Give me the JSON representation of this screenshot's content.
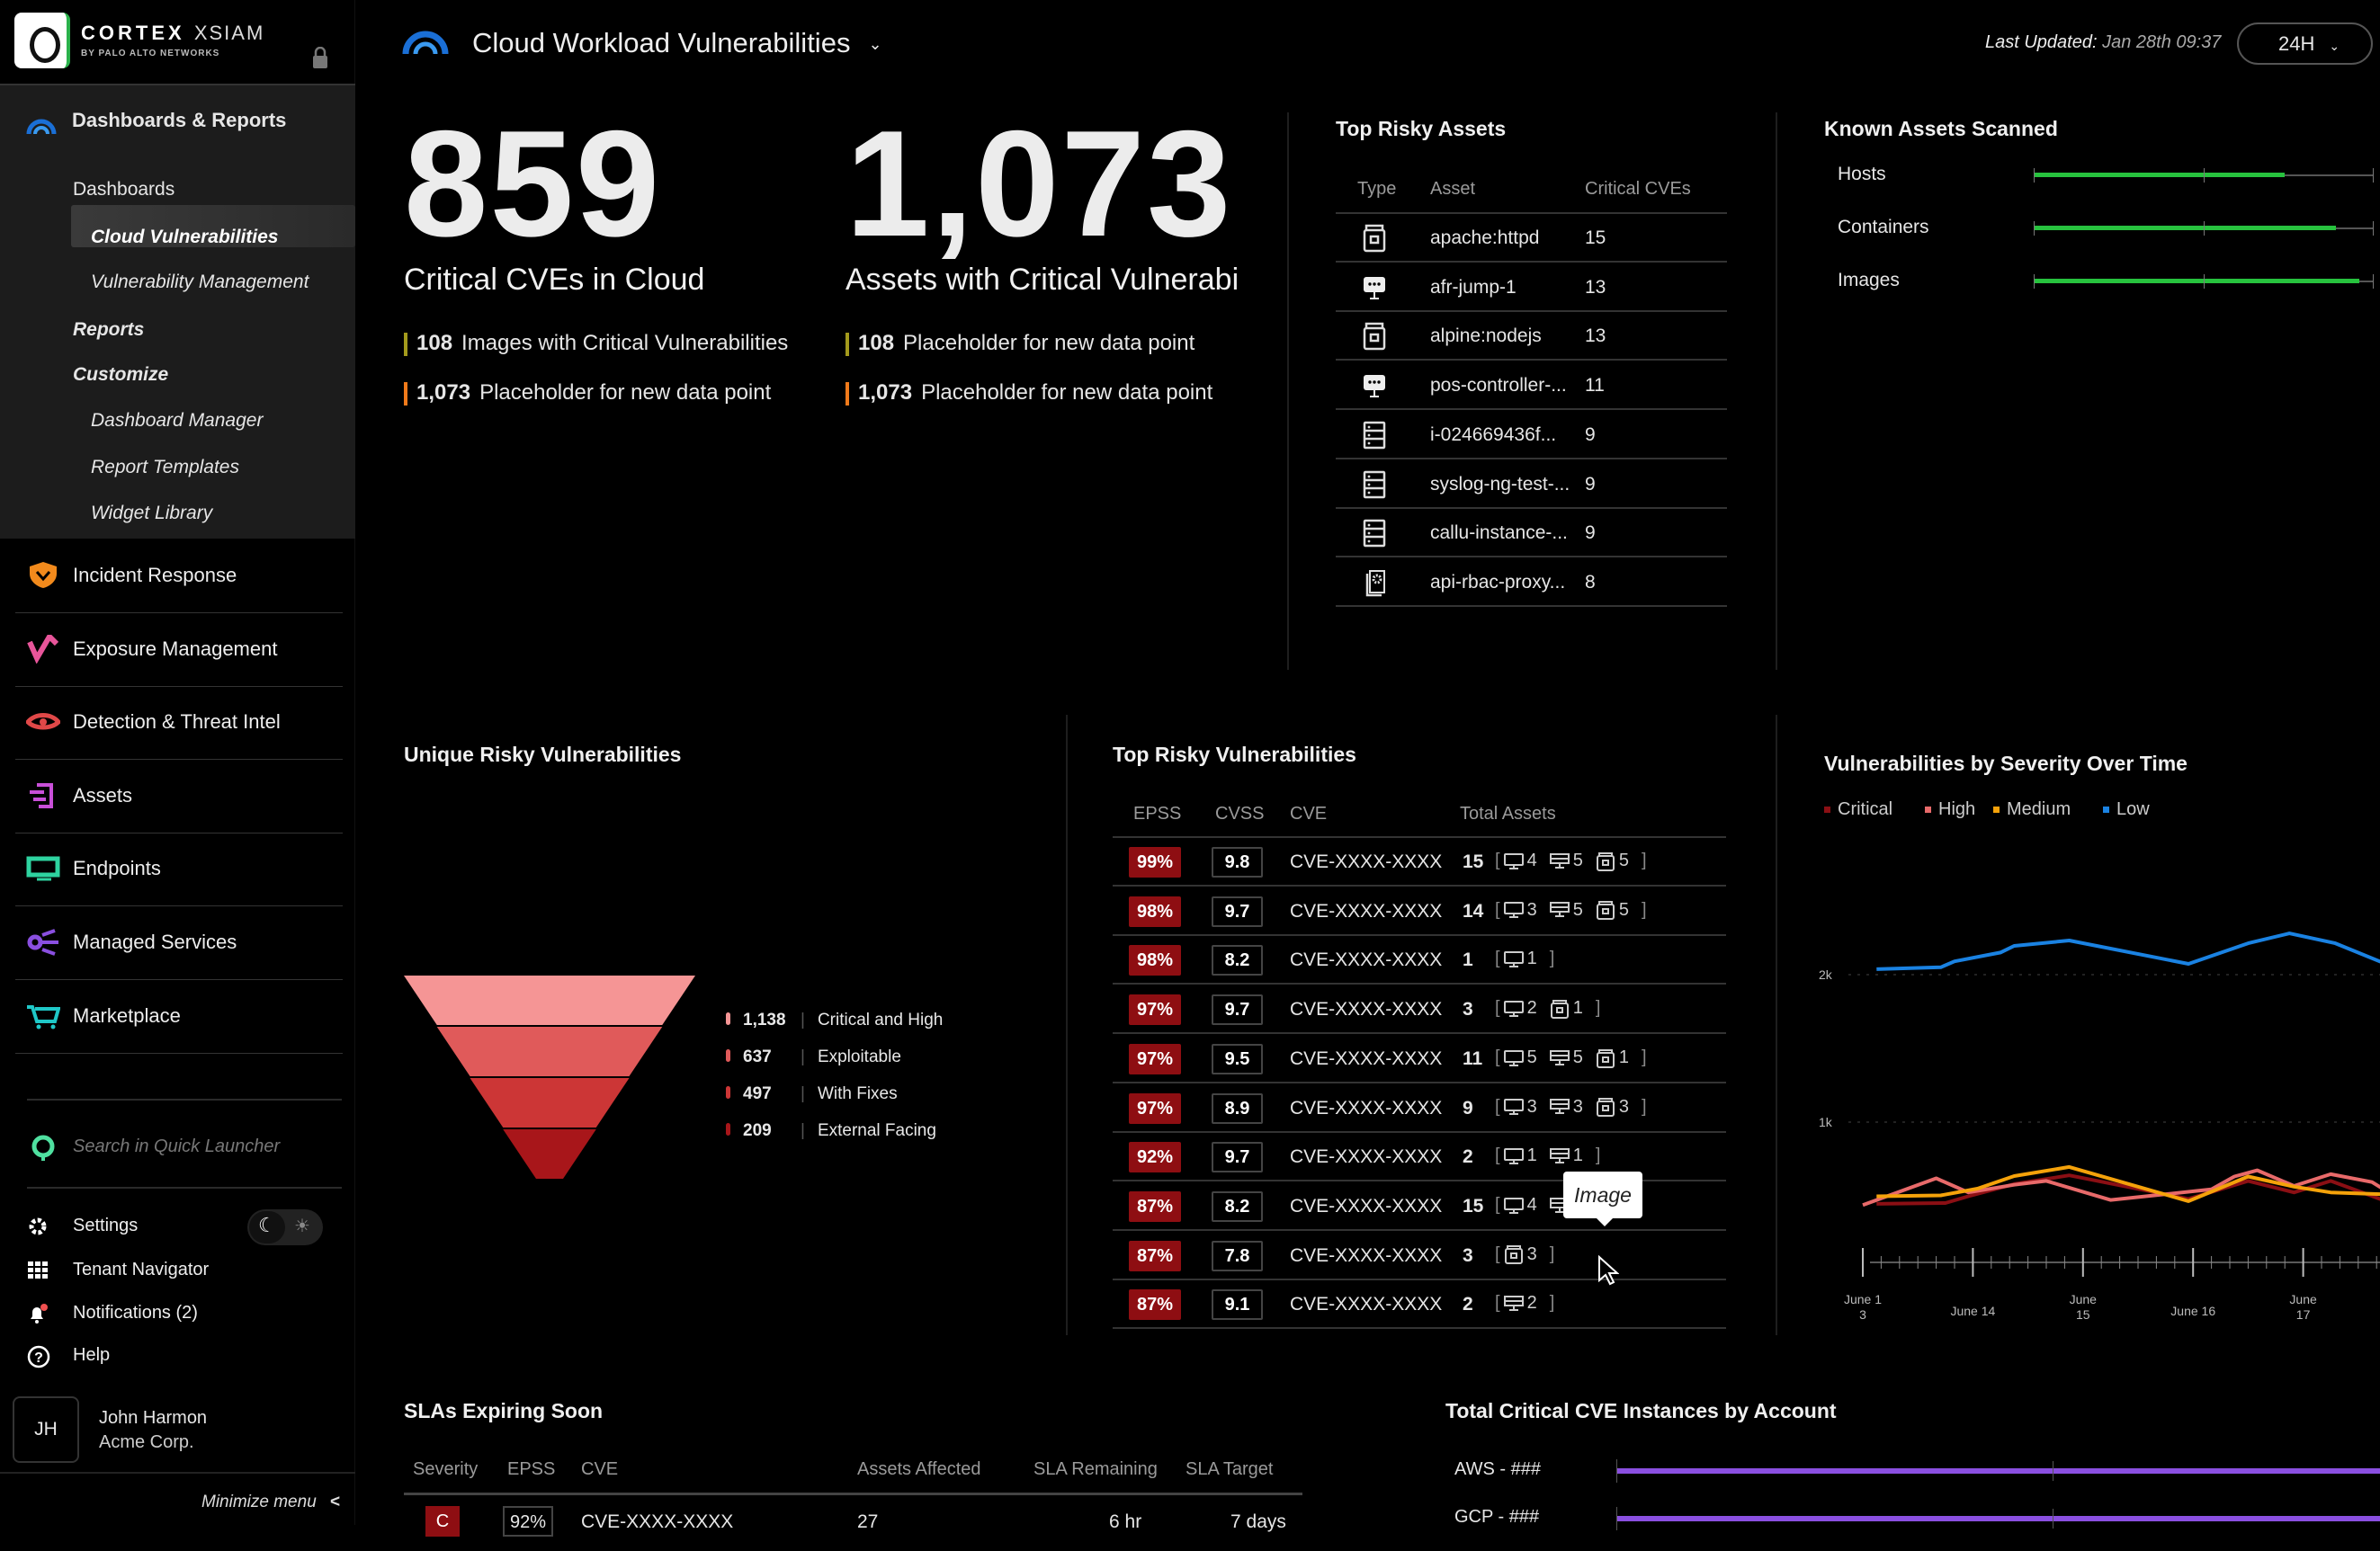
{
  "app": {
    "brand": "CORTEX",
    "brand_product": "XSIAM",
    "brand_sub": "BY PALO ALTO NETWORKS"
  },
  "sidebar": {
    "section": "Dashboards & Reports",
    "sub_items": [
      {
        "label": "Dashboards",
        "style": "plain"
      },
      {
        "label": "Cloud Vulnerabilities",
        "style": "selected"
      },
      {
        "label": "Vulnerability Management",
        "style": "italic"
      },
      {
        "label": "Reports",
        "style": "bold-italic"
      },
      {
        "label": "Customize",
        "style": "bold-italic"
      },
      {
        "label": "Dashboard Manager",
        "style": "italic"
      },
      {
        "label": "Report Templates",
        "style": "italic"
      },
      {
        "label": "Widget Library",
        "style": "italic"
      }
    ],
    "nav": [
      {
        "label": "Incident Response",
        "icon": "shield-icon",
        "color": "#f28a1c"
      },
      {
        "label": "Exposure Management",
        "icon": "exposure-icon",
        "color": "#e8559a"
      },
      {
        "label": "Detection & Threat Intel",
        "icon": "eye-icon",
        "color": "#e04848"
      },
      {
        "label": "Assets",
        "icon": "assets-icon",
        "color": "#c84fd8"
      },
      {
        "label": "Endpoints",
        "icon": "monitor-icon",
        "color": "#2ed3a0"
      },
      {
        "label": "Managed Services",
        "icon": "managed-services-icon",
        "color": "#8a4fe0"
      },
      {
        "label": "Marketplace",
        "icon": "cart-icon",
        "color": "#1fc8c8"
      }
    ],
    "search_placeholder": "Search in Quick Launcher",
    "settings": "Settings",
    "tenant_navigator": "Tenant Navigator",
    "notifications": "Notifications (2)",
    "help": "Help",
    "user": {
      "initials": "JH",
      "name": "John Harmon",
      "company": "Acme Corp."
    },
    "minimize": "Minimize menu",
    "theme": "dark"
  },
  "header": {
    "title": "Cloud Workload Vulnerabilities",
    "last_updated_label": "Last Updated:",
    "last_updated_value": "Jan 28th 09:37",
    "range": "24H"
  },
  "kpis": [
    {
      "value": "859",
      "label": "Critical CVEs in Cloud",
      "subs": [
        {
          "value": "108",
          "label": "Images with Critical Vulnerabilities",
          "color": "#a39a1c"
        },
        {
          "value": "1,073",
          "label": "Placeholder for new data point",
          "color": "#f07a1a"
        }
      ]
    },
    {
      "value": "1,073",
      "label": "Assets with Critical Vulnerabi",
      "subs": [
        {
          "value": "108",
          "label": "Placeholder for new data point",
          "color": "#a39a1c"
        },
        {
          "value": "1,073",
          "label": "Placeholder for new data point",
          "color": "#f07a1a"
        }
      ]
    }
  ],
  "top_risky_assets": {
    "title": "Top Risky Assets",
    "columns": [
      "Type",
      "Asset",
      "Critical CVEs"
    ],
    "rows": [
      {
        "type": "image",
        "asset": "apache:httpd",
        "cves": "15"
      },
      {
        "type": "host",
        "asset": "afr-jump-1",
        "cves": "13"
      },
      {
        "type": "image",
        "asset": "alpine:nodejs",
        "cves": "13"
      },
      {
        "type": "host",
        "asset": "pos-controller-...",
        "cves": "11"
      },
      {
        "type": "server",
        "asset": "i-024669436f...",
        "cves": "9"
      },
      {
        "type": "server",
        "asset": "syslog-ng-test-...",
        "cves": "9"
      },
      {
        "type": "server",
        "asset": "callu-instance-...",
        "cves": "9"
      },
      {
        "type": "config",
        "asset": "api-rbac-proxy...",
        "cves": "8"
      }
    ]
  },
  "known_assets": {
    "title": "Known Assets Scanned",
    "rows": [
      {
        "label": "Hosts",
        "fraction": 0.74
      },
      {
        "label": "Containers",
        "fraction": 0.89
      },
      {
        "label": "Images",
        "fraction": 0.96
      }
    ],
    "color": "#27c23e"
  },
  "unique_risky": {
    "title": "Unique Risky Vulnerabilities",
    "stages": [
      {
        "value": "1,138",
        "label": "Critical and High",
        "color": "#f59595"
      },
      {
        "value": "637",
        "label": "Exploitable",
        "color": "#e05a5a"
      },
      {
        "value": "497",
        "label": "With Fixes",
        "color": "#cc3636"
      },
      {
        "value": "209",
        "label": "External Facing",
        "color": "#a8161a"
      }
    ]
  },
  "top_risky_vulns": {
    "title": "Top Risky Vulnerabilities",
    "columns": [
      "EPSS",
      "CVSS",
      "CVE",
      "Total Assets"
    ],
    "rows": [
      {
        "epss": "99%",
        "cvss": "9.8",
        "cve": "CVE-XXXX-XXXX",
        "total": "15",
        "breakdown": [
          {
            "t": "host",
            "n": "4"
          },
          {
            "t": "server",
            "n": "5"
          },
          {
            "t": "image",
            "n": "5"
          }
        ]
      },
      {
        "epss": "98%",
        "cvss": "9.7",
        "cve": "CVE-XXXX-XXXX",
        "total": "14",
        "breakdown": [
          {
            "t": "host",
            "n": "3"
          },
          {
            "t": "server",
            "n": "5"
          },
          {
            "t": "image",
            "n": "5"
          }
        ]
      },
      {
        "epss": "98%",
        "cvss": "8.2",
        "cve": "CVE-XXXX-XXXX",
        "total": "1",
        "breakdown": [
          {
            "t": "host",
            "n": "1"
          }
        ]
      },
      {
        "epss": "97%",
        "cvss": "9.7",
        "cve": "CVE-XXXX-XXXX",
        "total": "3",
        "breakdown": [
          {
            "t": "host",
            "n": "2"
          },
          {
            "t": "image",
            "n": "1"
          }
        ]
      },
      {
        "epss": "97%",
        "cvss": "9.5",
        "cve": "CVE-XXXX-XXXX",
        "total": "11",
        "breakdown": [
          {
            "t": "host",
            "n": "5"
          },
          {
            "t": "server",
            "n": "5"
          },
          {
            "t": "image",
            "n": "1"
          }
        ]
      },
      {
        "epss": "97%",
        "cvss": "8.9",
        "cve": "CVE-XXXX-XXXX",
        "total": "9",
        "breakdown": [
          {
            "t": "host",
            "n": "3"
          },
          {
            "t": "server",
            "n": "3"
          },
          {
            "t": "image",
            "n": "3"
          }
        ]
      },
      {
        "epss": "92%",
        "cvss": "9.7",
        "cve": "CVE-XXXX-XXXX",
        "total": "2",
        "breakdown": [
          {
            "t": "host",
            "n": "1"
          },
          {
            "t": "server",
            "n": "1"
          }
        ]
      },
      {
        "epss": "87%",
        "cvss": "8.2",
        "cve": "CVE-XXXX-XXXX",
        "total": "15",
        "breakdown": [
          {
            "t": "host",
            "n": "4"
          },
          {
            "t": "server",
            "n": ""
          }
        ]
      },
      {
        "epss": "87%",
        "cvss": "7.8",
        "cve": "CVE-XXXX-XXXX",
        "total": "3",
        "breakdown": [
          {
            "t": "image",
            "n": "3"
          }
        ]
      },
      {
        "epss": "87%",
        "cvss": "9.1",
        "cve": "CVE-XXXX-XXXX",
        "total": "2",
        "breakdown": [
          {
            "t": "server",
            "n": "2"
          }
        ]
      }
    ],
    "tooltip": "Image"
  },
  "chart_data": {
    "type": "line",
    "title": "Vulnerabilities by Severity Over Time",
    "legend_position": "top-left",
    "grid": "dotted horizontal",
    "yticks": [
      {
        "v": 1000,
        "label": "1k"
      },
      {
        "v": 2000,
        "label": "2k"
      }
    ],
    "xticks": [
      {
        "x": "06-13 00:00",
        "label": [
          "June 1",
          "3"
        ]
      },
      {
        "x": "06-14 00:00",
        "label": [
          "June 14"
        ]
      },
      {
        "x": "06-15 00:00",
        "label": [
          "June",
          "15"
        ]
      },
      {
        "x": "06-16 00:00",
        "label": [
          "June 16"
        ]
      },
      {
        "x": "06-17 00:00",
        "label": [
          "June",
          "17"
        ]
      }
    ],
    "series": [
      {
        "name": "Critical",
        "color": "#8b0f14",
        "points": [
          [
            "06-13 03:00",
            446
          ],
          [
            "06-13 18:00",
            451
          ],
          [
            "06-13 23:00",
            497
          ],
          [
            "06-14 09:00",
            580
          ],
          [
            "06-14 21:00",
            639
          ],
          [
            "06-15 23:00",
            479
          ],
          [
            "06-16 12:00",
            601
          ],
          [
            "06-16 22:00",
            523
          ],
          [
            "06-17 06:00",
            601
          ],
          [
            "06-17 18:00",
            464
          ]
        ]
      },
      {
        "name": "High",
        "color": "#e86a6a",
        "points": [
          [
            "06-13 00:00",
            438
          ],
          [
            "06-13 16:00",
            619
          ],
          [
            "06-13 23:00",
            523
          ],
          [
            "06-14 09:00",
            575
          ],
          [
            "06-14 16:00",
            601
          ],
          [
            "06-15 06:00",
            472
          ],
          [
            "06-16 04:00",
            544
          ],
          [
            "06-16 09:00",
            631
          ],
          [
            "06-16 14:00",
            673
          ],
          [
            "06-16 22:00",
            567
          ],
          [
            "06-17 06:00",
            647
          ],
          [
            "06-17 15:00",
            593
          ],
          [
            "06-17 18:00",
            536
          ]
        ]
      },
      {
        "name": "Medium",
        "color": "#f5a20a",
        "points": [
          [
            "06-13 03:00",
            497
          ],
          [
            "06-13 17:00",
            503
          ],
          [
            "06-14 01:00",
            549
          ],
          [
            "06-14 09:00",
            634
          ],
          [
            "06-14 21:00",
            696
          ],
          [
            "06-15 23:00",
            464
          ],
          [
            "06-16 12:00",
            631
          ],
          [
            "06-16 22:00",
            562
          ],
          [
            "06-17 06:00",
            523
          ],
          [
            "06-17 18:00",
            510
          ]
        ]
      },
      {
        "name": "Low",
        "color": "#1a82e2",
        "points": [
          [
            "06-13 03:00",
            2037
          ],
          [
            "06-13 17:00",
            2050
          ],
          [
            "06-13 20:00",
            2090
          ],
          [
            "06-14 06:00",
            2150
          ],
          [
            "06-14 09:00",
            2195
          ],
          [
            "06-14 21:00",
            2232
          ],
          [
            "06-15 23:00",
            2073
          ],
          [
            "06-16 12:00",
            2213
          ],
          [
            "06-16 21:00",
            2280
          ],
          [
            "06-17 07:00",
            2213
          ],
          [
            "06-17 18:00",
            2073
          ]
        ]
      }
    ]
  },
  "slas": {
    "title": "SLAs Expiring Soon",
    "columns": [
      "Severity",
      "EPSS",
      "CVE",
      "Assets Affected",
      "SLA Remaining",
      "SLA Target"
    ],
    "rows": [
      {
        "severity": "C",
        "epss": "92%",
        "cve": "CVE-XXXX-XXXX",
        "assets": "27",
        "remaining": "6 hr",
        "target": "7 days"
      }
    ]
  },
  "by_account": {
    "title": "Total Critical CVE Instances by Account",
    "rows": [
      {
        "label": "AWS - ###"
      },
      {
        "label": "GCP - ###"
      }
    ],
    "color": "#8a4fe0"
  }
}
